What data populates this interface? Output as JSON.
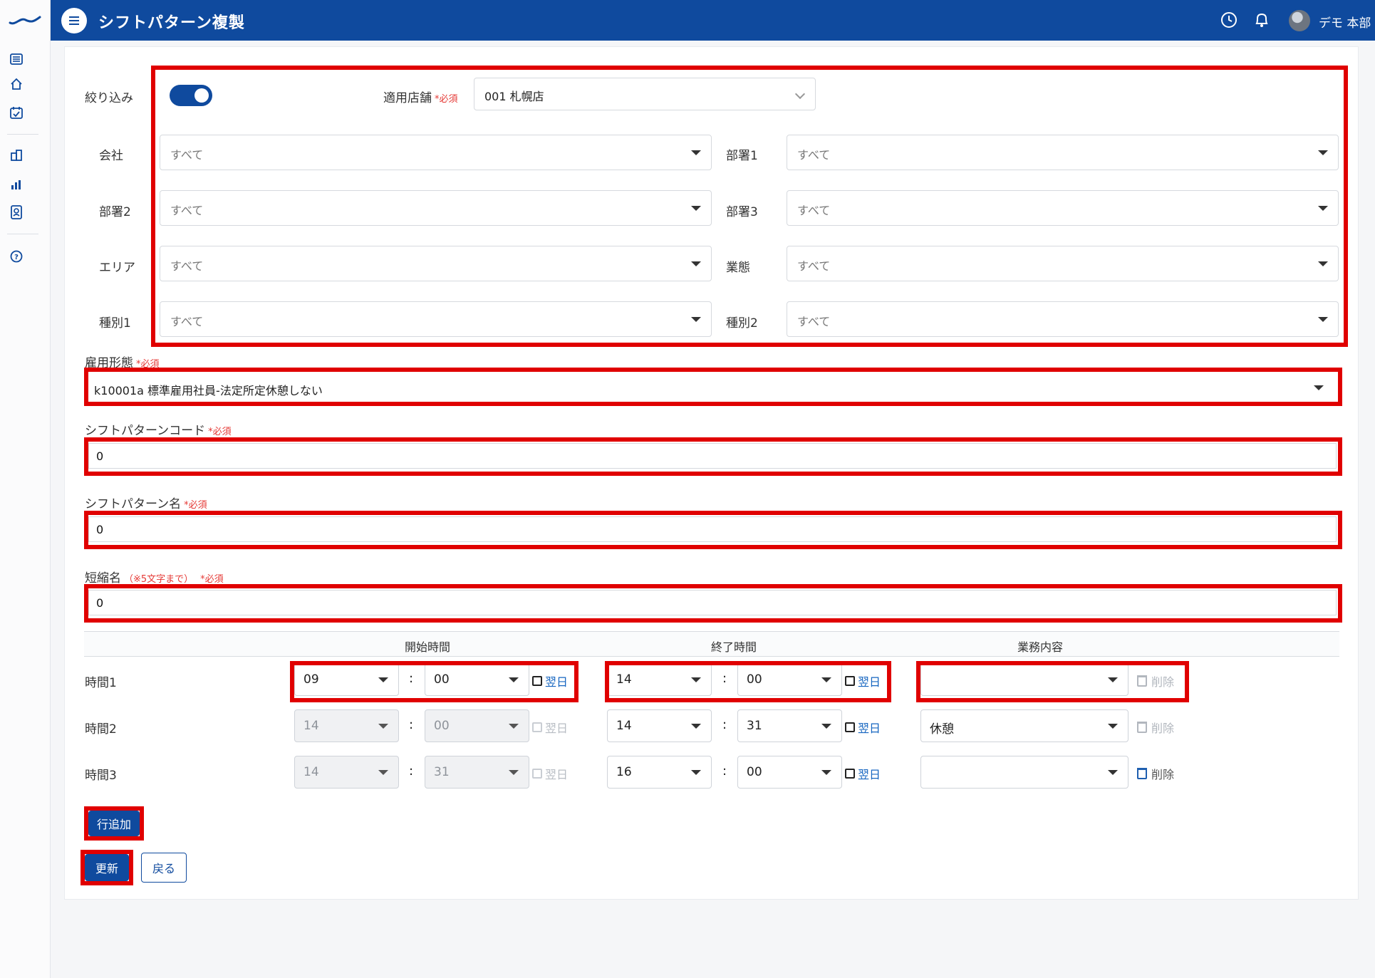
{
  "header": {
    "title": "シフトパターン複製",
    "user_name": "デモ 本部",
    "icons": [
      "menu-icon",
      "clock-icon",
      "bell-icon",
      "avatar"
    ]
  },
  "sidebar": {
    "icons": [
      "list-icon",
      "home-icon",
      "calendar-check-icon",
      "building-icon",
      "bar-chart-icon",
      "id-card-icon",
      "help-icon"
    ]
  },
  "filter": {
    "label": "絞り込み",
    "enabled": true,
    "store_label": "適用店舗",
    "required": "*必須",
    "store_value": "001 札幌店",
    "fields": [
      {
        "label": "会社",
        "value": "すべて"
      },
      {
        "label": "部署1",
        "value": "すべて"
      },
      {
        "label": "部署2",
        "value": "すべて"
      },
      {
        "label": "部署3",
        "value": "すべて"
      },
      {
        "label": "エリア",
        "value": "すべて"
      },
      {
        "label": "業態",
        "value": "すべて"
      },
      {
        "label": "種別1",
        "value": "すべて"
      },
      {
        "label": "種別2",
        "value": "すべて"
      }
    ]
  },
  "form": {
    "employment_label": "雇用形態",
    "employment_value": "k10001a 標準雇用社員-法定所定休憩しない",
    "code_label": "シフトパターンコード",
    "code_value": "0",
    "name_label": "シフトパターン名",
    "name_value": "0",
    "short_label": "短縮名",
    "short_hint": "（※5文字まで）",
    "short_value": "0",
    "required": "*必須"
  },
  "times": {
    "headers": {
      "start": "開始時間",
      "end": "終了時間",
      "task": "業務内容"
    },
    "colon": ":",
    "next_day": "翌日",
    "delete": "削除",
    "rows": [
      {
        "label": "時間1",
        "start_h": "09",
        "start_m": "00",
        "end_h": "14",
        "end_m": "00",
        "task": ""
      },
      {
        "label": "時間2",
        "start_h": "14",
        "start_m": "00",
        "end_h": "14",
        "end_m": "31",
        "task": "休憩"
      },
      {
        "label": "時間3",
        "start_h": "14",
        "start_m": "31",
        "end_h": "16",
        "end_m": "00",
        "task": ""
      }
    ]
  },
  "buttons": {
    "add_row": "行追加",
    "update": "更新",
    "back": "戻る"
  },
  "colors": {
    "primary": "#0f4a9e",
    "highlight": "#e00000",
    "required": "#e53935"
  }
}
